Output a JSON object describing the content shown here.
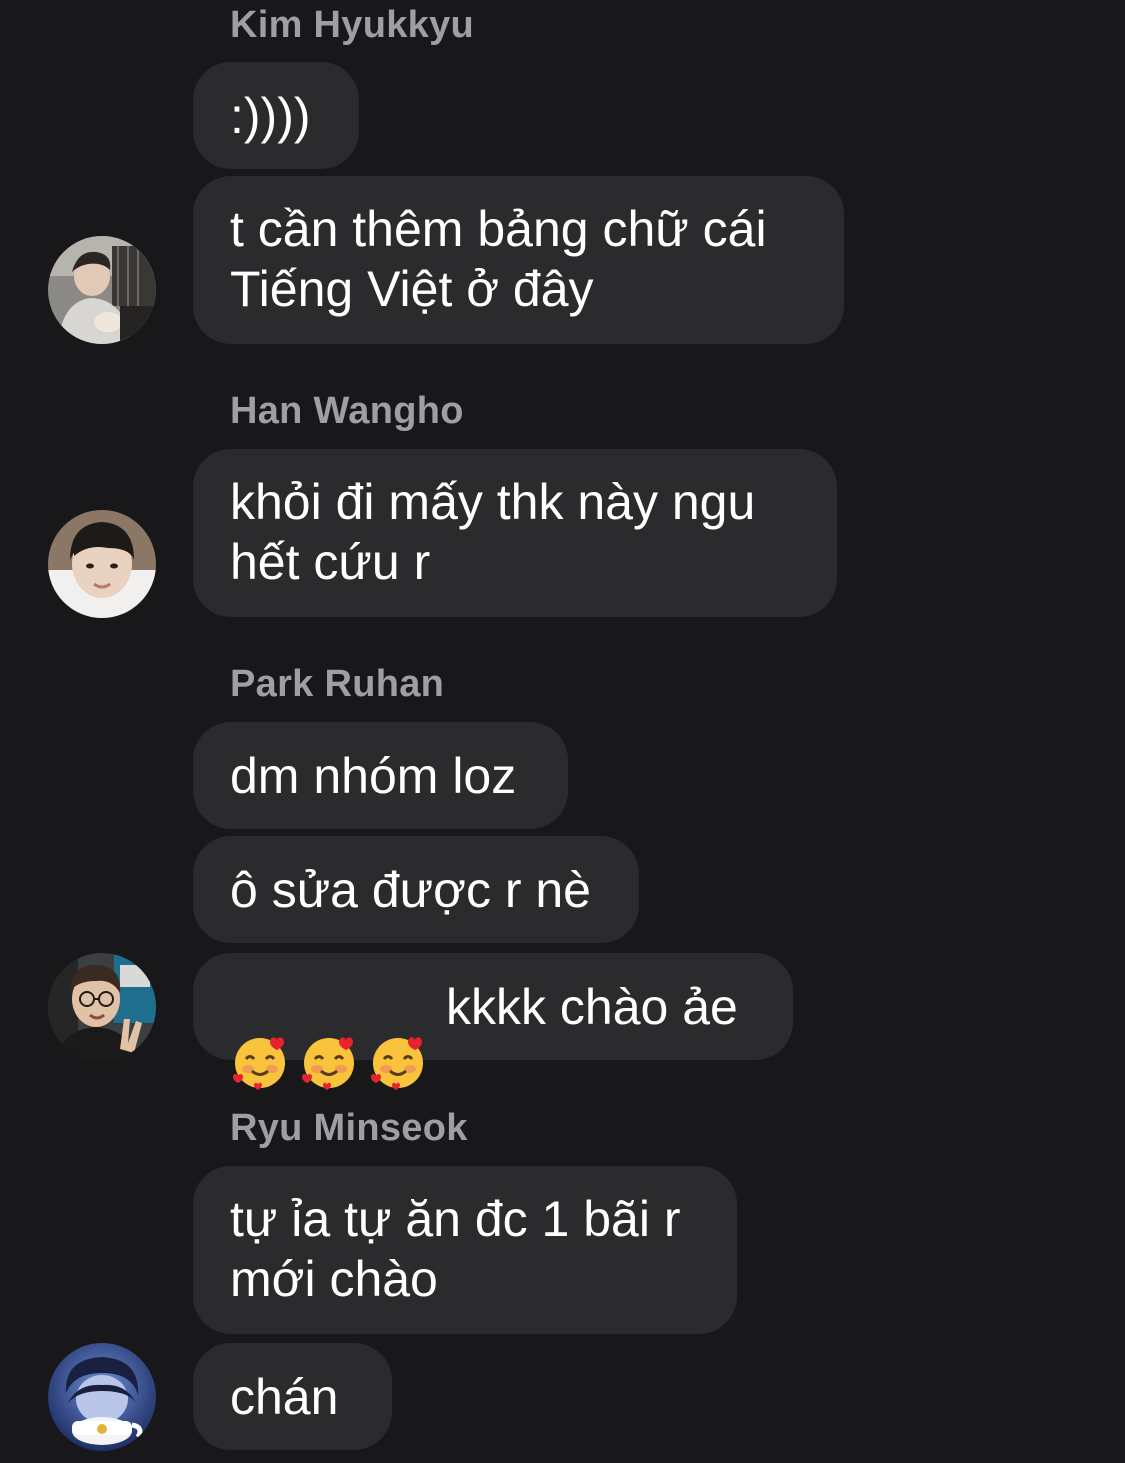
{
  "messages": [
    {
      "sender": "Kim Hyukkyu",
      "bubbles": [
        ":))))",
        "t cần thêm bảng chữ cái\nTiếng Việt ở đây"
      ],
      "avatar": "avatar-kim-hyukkyu"
    },
    {
      "sender": "Han Wangho",
      "bubbles": [
        "khỏi đi mấy thk này ngu\nhết cứu r"
      ],
      "avatar": "avatar-han-wangho"
    },
    {
      "sender": "Park Ruhan",
      "bubbles": [
        "dm nhóm loz",
        "ô sửa được r nè",
        "kkkk chào ảe"
      ],
      "emoji": "smiling-face-with-hearts-icon",
      "avatar": "avatar-park-ruhan"
    },
    {
      "sender": "Ryu Minseok",
      "bubbles": [
        "tự ỉa tự ăn đc 1 bãi r\nmới chào",
        "chán"
      ],
      "avatar": "avatar-ryu-minseok"
    }
  ],
  "colors": {
    "background": "#18181a",
    "bubble": "#2b2b2e",
    "sender_name": "#9e9ea3",
    "text": "#ffffff"
  }
}
